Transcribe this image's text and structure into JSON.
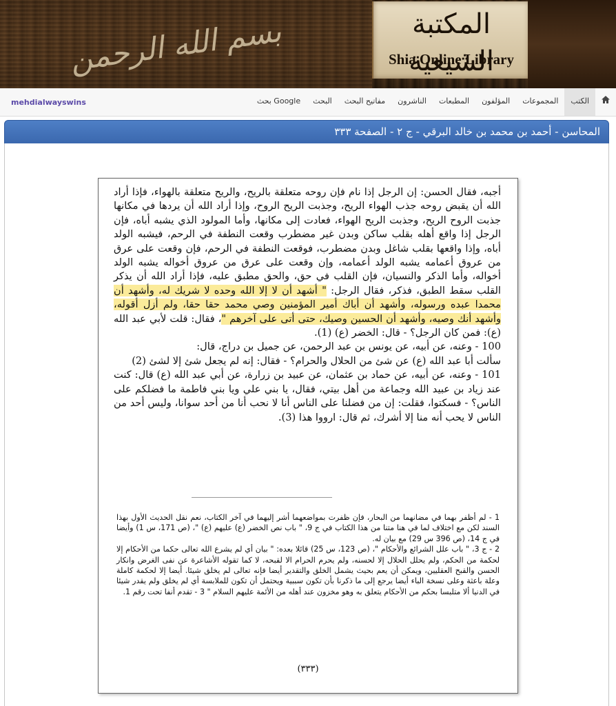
{
  "header": {
    "logo_ar": "المكتبة الشيعية",
    "logo_en": "Shia Online Library",
    "calligraphy": "بسم الله الرحمن الرحيم"
  },
  "nav": {
    "user": "mehdialwayswins",
    "home_icon": "home-icon",
    "items": [
      "الكتب",
      "المجموعات",
      "المؤلفون",
      "المطبعات",
      "الناشرون",
      "مفاتيح البحث",
      "البحث",
      "بحث Google"
    ]
  },
  "title": "المحاسن - أحمد بن محمد بن خالد البرقي - ج ٢ - الصفحة ٣٣٣",
  "page": {
    "main_before": "أجبه، فقال الحسن: إن الرجل إذا نام فإن روحه متعلقة بالريح، والريح متعلقة بالهواء، فإذا أراد الله أن يقبض روحه جذب الهواء الريح، وجذبت الريح الروح، وإذا أراد الله أن يردها في مكانها جذبت الروح الريح، وجذبت الريح الهواء، فعادت إلى مكانها، وأما المولود الذي يشبه أباه، فإن الرجل إذا واقع أهله بقلب ساكن وبدن غير مضطرب وقعت النطفة في الرحم، فيشبه الولد أباه، وإذا واقعها بقلب شاغل وبدن مضطرب، فوقعت النطفة في الرحم، فإن وقعت على عرق من عروق أعمامه يشبه الولد أعمامه، وإن وقعت على عرق من عروق أخواله يشبه الولد أخواله، وأما الذكر والنسيان، فإن القلب في حق، والحق مطبق عليه، فإذا أراد الله أن يذكر القلب سقط الطبق، فذكر، فقال الرجل: ",
    "main_highlight": "\" أشهد أن لا إلا الله وحده لا شريك له، وأشهد أن محمدا عبده ورسوله، وأشهد أن أباك أمير المؤمنين وصي محمد حقا حقا، ولم أزل أقوله، وأشهد أنك وصيه، وأشهد أن الحسين وصيك، حتى أتى على آخرهم \"",
    "main_after": "، فقال: قلت لأبي عبد الله (ع): فمن كان الرجل؟ - قال: الخضر (ع) (1).",
    "para2": "100 - وعنه، عن أبيه، عن يونس بن عبد الرحمن، عن جميل بن دراج، قال:",
    "para3": "سألت أبا عبد الله (ع) عن شئ من الحلال والحرام؟ - فقال: إنه لم يجعل شئ إلا لشئ (2)",
    "para4": "101 - وعنه، عن أبيه، عن حماد بن عثمان، عن عبيد بن زرارة، عن أبي عبد الله (ع) قال: كنت عند زياد بن عبيد الله وجماعة من أهل بيتي، فقال، يا بني علي ويا بني فاطمة ما فضلكم على الناس؟ - فسكتوا، فقلت: إن من فضلنا على الناس أنا لا نحب أنا من أحد سوانا، وليس أحد من الناس لا يحب أنه منا إلا أشرك، ثم قال: ارووا هذا (3).",
    "foot1": "1 - لم أظفر بهما في مضانهما من البحار، فإن ظفرت بمواضعهما أشر إليهما في آخر الكتاب، نعم نقل الحديث الأول بهذا السند لكن مع اختلاف لما في هنا متنا من هذا الكتاب في ج 9، \" باب نص الخضر (ع) عليهم (ع) \"، (ص 171، س 1) وأيضا في ج 14، (ص 396 س 29) مع بيان له.",
    "foot2": "2 - ج 3، \" باب علل الشرائع والأحكام \"، (ص 123، س 25) قائلا بعده: \" بيان أي لم يشرع الله تعالى حكما من الأحكام إلا لحكمة من الحكم، ولم يحلل الحلال إلا لحسنه، ولم يحرم الحرام الا لقبحه، لا كما تقوله الأشاعرة عن نفى الغرض وانكار الحسن والقبح العقليين، ويمكن أن يعم بحيث يشمل الخلق والتقدير أيضا فإنه تعالى لم يخلق شيئا. أيضا إلا لحكمة كاملة وعلة باعثة وعلى نسخة الباء أيضا يرجع إلى ما ذكرنا بأن تكون سببية ويحتمل أن تكون للملابسة أي لم يخلق ولم يقدر شيئا في الدنيا ألا متلبسا بحكم من الأحكام يتعلق به وهو مخزون عند أهله من الأئمة عليهم السلام \" 3 - تقدم أنفا تحت رقم 1.",
    "page_number": "(٣٣٣)"
  },
  "colors": {
    "titlebar": "#3a67ad",
    "highlight": "#fbeb9a",
    "username": "#5b4aa8"
  }
}
